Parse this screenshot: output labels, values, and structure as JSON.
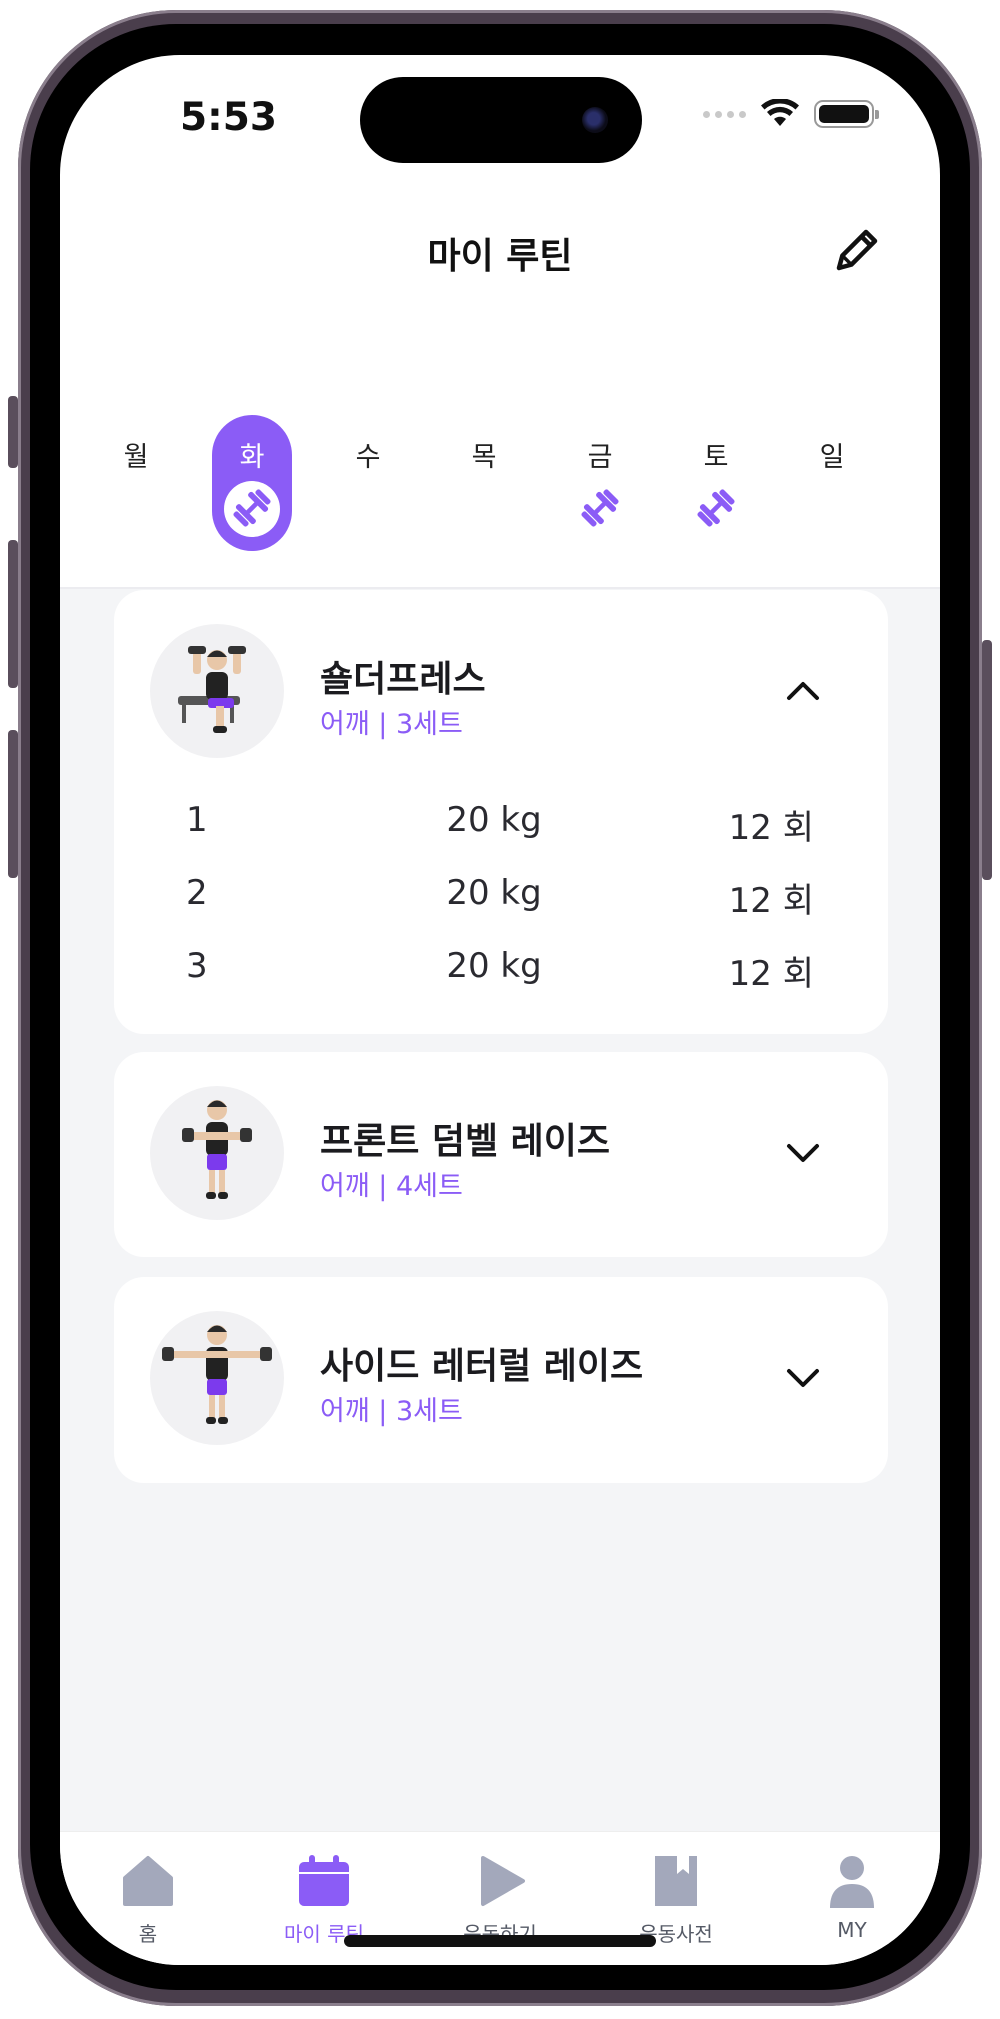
{
  "status_bar": {
    "time": "5:53"
  },
  "header": {
    "title": "마이 루틴",
    "edit_icon": "pencil-icon"
  },
  "weekdays": [
    {
      "label": "월",
      "selected": false,
      "has_workout": false
    },
    {
      "label": "화",
      "selected": true,
      "has_workout": true
    },
    {
      "label": "수",
      "selected": false,
      "has_workout": false
    },
    {
      "label": "목",
      "selected": false,
      "has_workout": false
    },
    {
      "label": "금",
      "selected": false,
      "has_workout": true
    },
    {
      "label": "토",
      "selected": false,
      "has_workout": true
    },
    {
      "label": "일",
      "selected": false,
      "has_workout": false
    }
  ],
  "exercises": [
    {
      "name": "숄더프레스",
      "subtitle": "어깨 | 3세트",
      "expanded": true,
      "sets": [
        {
          "num": "1",
          "weight": "20 kg",
          "reps": "12 회"
        },
        {
          "num": "2",
          "weight": "20 kg",
          "reps": "12 회"
        },
        {
          "num": "3",
          "weight": "20 kg",
          "reps": "12 회"
        }
      ]
    },
    {
      "name": "프론트 덤벨 레이즈",
      "subtitle": "어깨 | 4세트",
      "expanded": false
    },
    {
      "name": "사이드 레터럴 레이즈",
      "subtitle": "어깨 | 3세트",
      "expanded": false
    }
  ],
  "tabbar": {
    "items": [
      {
        "label": "홈",
        "icon": "home-icon",
        "active": false
      },
      {
        "label": "마이 루틴",
        "icon": "calendar-icon",
        "active": true
      },
      {
        "label": "운동하기",
        "icon": "play-icon",
        "active": false
      },
      {
        "label": "운동사전",
        "icon": "book-icon",
        "active": false
      },
      {
        "label": "MY",
        "icon": "person-icon",
        "active": false
      }
    ]
  },
  "colors": {
    "accent": "#8b5cf6",
    "inactive_icon": "#a3a8bb",
    "content_bg": "#f4f5f7"
  }
}
